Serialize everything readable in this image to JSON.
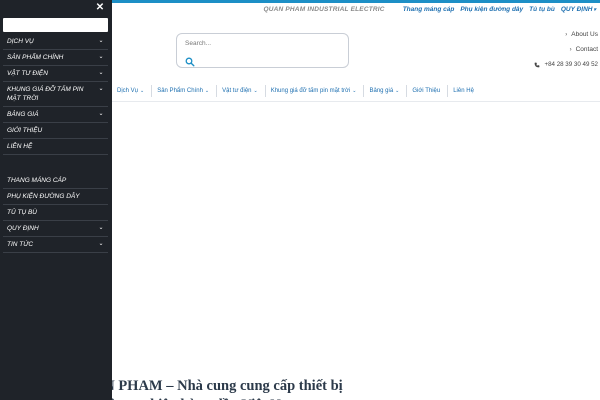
{
  "sidebar": {
    "search_placeholder": "",
    "items": [
      {
        "label": "Dịch vụ",
        "chevron": true
      },
      {
        "label": "Sản phẩm chính",
        "chevron": true
      },
      {
        "label": "Vật tư điện",
        "chevron": true
      },
      {
        "label": "Khung giá đỡ tấm pin mặt trời",
        "chevron": true
      },
      {
        "label": "Bảng giá",
        "chevron": true
      },
      {
        "label": "Giới thiệu",
        "chevron": false
      },
      {
        "label": "Liên hệ",
        "chevron": false
      }
    ],
    "items2": [
      {
        "label": "Thang máng cáp",
        "chevron": false
      },
      {
        "label": "Phụ kiện đường dây",
        "chevron": false
      },
      {
        "label": "Tủ tụ bù",
        "chevron": false
      },
      {
        "label": "Quy định",
        "chevron": true
      },
      {
        "label": "Tin tức",
        "chevron": true
      }
    ]
  },
  "topbar": {
    "company": "QUAN PHAM INDUSTRIAL ELECTRIC",
    "links": [
      "Thang máng cáp",
      "Phụ kiện đường dây",
      "Tủ tụ bù",
      "QUY ĐỊNH"
    ]
  },
  "search": {
    "placeholder": "Search..."
  },
  "right_links": {
    "about": "About Us",
    "contact": "Contact",
    "phone": "+84 28 39 30 49 52"
  },
  "nav": {
    "items": [
      {
        "label": "Dịch Vụ",
        "chevron": true
      },
      {
        "label": "Sản Phẩm Chính",
        "chevron": true
      },
      {
        "label": "Vật tư điện",
        "chevron": true
      },
      {
        "label": "Khung giá đỡ tấm pin mặt trời",
        "chevron": true
      },
      {
        "label": "Bảng giá",
        "chevron": true
      },
      {
        "label": "Giới Thiệu",
        "chevron": false
      },
      {
        "label": "Liên Hệ",
        "chevron": false
      }
    ]
  },
  "hero": {
    "title": "QUAN PHAM – Nhà cung cung cấp thiết bị điện công nghiệp hàng đầu Việt Nam"
  },
  "colors": {
    "sidebar_bg": "#1f2329",
    "accent": "#1d8fc6",
    "link": "#1d6fb0"
  }
}
